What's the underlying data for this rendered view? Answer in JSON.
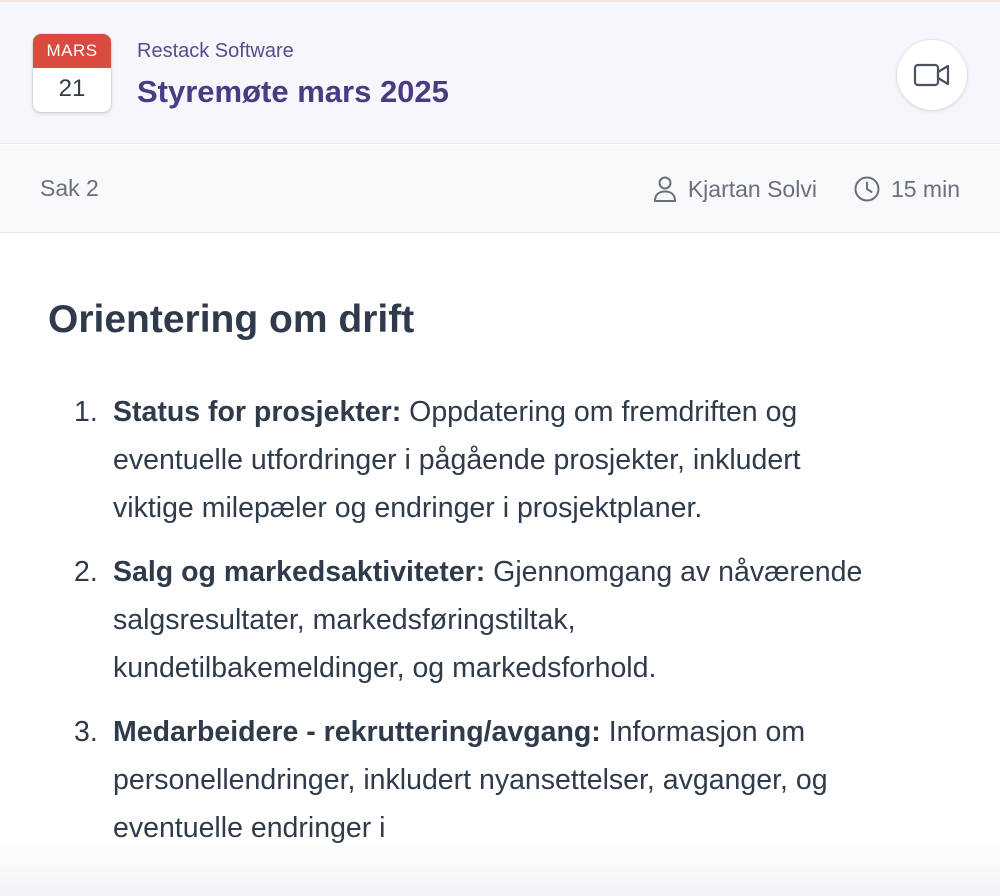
{
  "header": {
    "calendar": {
      "month": "MARS",
      "day": "21"
    },
    "organization": "Restack Software",
    "title": "Styremøte mars 2025",
    "video_icon": "video-camera-icon"
  },
  "subbar": {
    "item_label": "Sak 2",
    "presenter": "Kjartan Solvi",
    "duration": "15 min",
    "presenter_icon": "user-icon",
    "duration_icon": "clock-icon"
  },
  "content": {
    "heading": "Orientering om drift",
    "items": [
      {
        "number": "1.",
        "title": "Status for prosjekter:",
        "text": " Oppdatering om fremdriften og eventuelle utfordringer i pågående prosjekter, inkludert viktige milepæler og endringer i prosjektplaner."
      },
      {
        "number": "2.",
        "title": "Salg og markedsaktiviteter:",
        "text": " Gjennomgang av nåværende salgsresultater, markedsføringstiltak, kundetilbakemeldinger, og markedsforhold."
      },
      {
        "number": "3.",
        "title": "Medarbeidere - rekruttering/avgang:",
        "text": " Informasjon om personellendringer, inkludert nyansettelser, avganger, og eventuelle endringer i"
      }
    ]
  },
  "colors": {
    "calendar_month_bg": "#d94b3f",
    "title": "#4a3b82",
    "organization": "#5b4a8f",
    "body_text": "#2f3a4a",
    "muted_text": "#68707c"
  }
}
